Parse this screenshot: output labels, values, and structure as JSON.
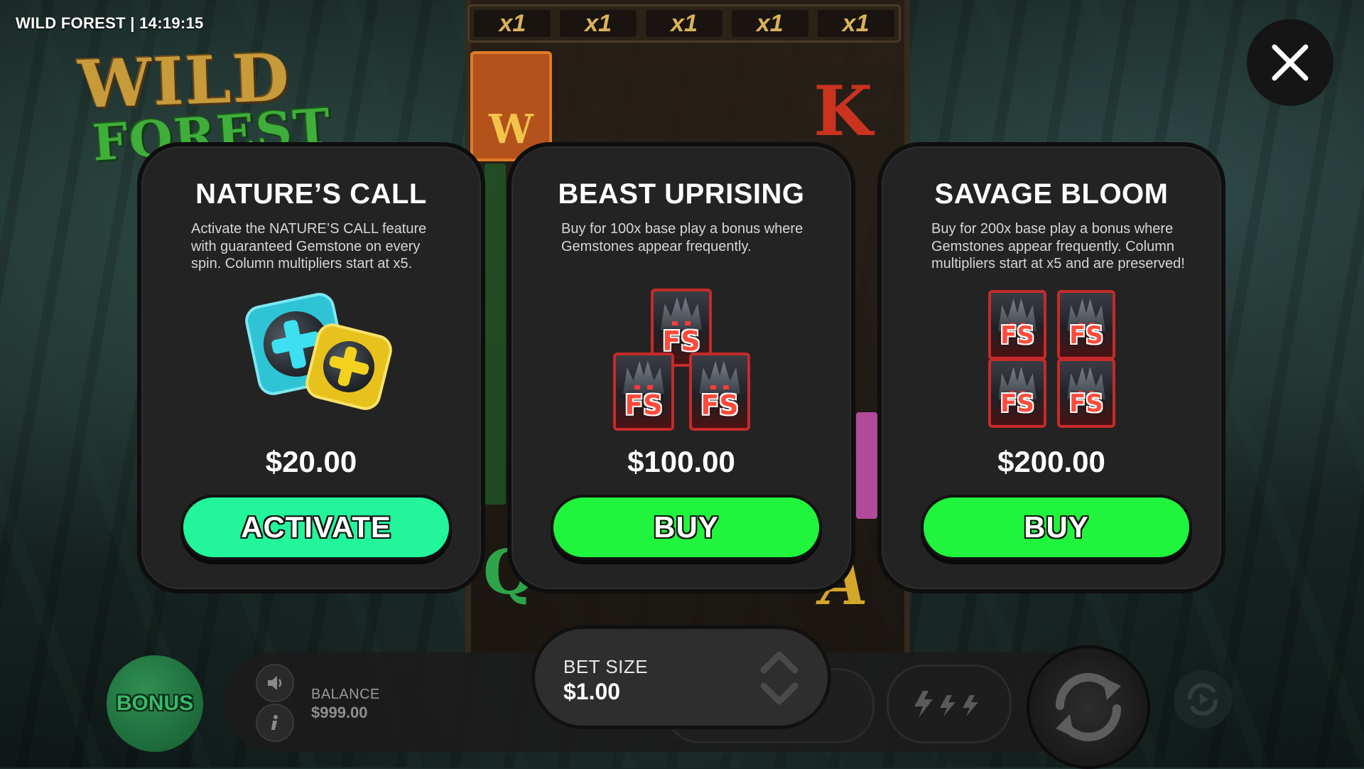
{
  "hud": {
    "title": "WILD FOREST | 14:19:15"
  },
  "logo": {
    "line1": "WILD",
    "line2": "FOREST"
  },
  "board": {
    "multipliers": [
      "x1",
      "x1",
      "x1",
      "x1",
      "x1"
    ],
    "symbols": {
      "w": "W",
      "k": "K",
      "a": "A",
      "q": "Q"
    }
  },
  "close": {
    "icon": "close-icon"
  },
  "cards": [
    {
      "title": "NATURE’S CALL",
      "description": "Activate the NATURE’S CALL feature with guaranteed Gemstone on every spin. Column multipliers start at x5.",
      "price": "$20.00",
      "button": "ACTIVATE",
      "button_color": "#22f59a",
      "art": "gemstone-icons"
    },
    {
      "title": "BEAST UPRISING",
      "description": "Buy for 100x base play a bonus where Gemstones appear frequently.",
      "price": "$100.00",
      "button": "BUY",
      "button_color": "#20f43c",
      "art": "fs-scatter-3",
      "fs_label": "FS"
    },
    {
      "title": "SAVAGE BLOOM",
      "description": "Buy for 200x base play a bonus where Gemstones appear frequently. Column multipliers start at x5 and are preserved!",
      "price": "$200.00",
      "button": "BUY",
      "button_color": "#20f43c",
      "art": "fs-scatter-4",
      "fs_label": "FS"
    }
  ],
  "bottom": {
    "bonus_label": "BONUS",
    "balance_label": "BALANCE",
    "balance_value": "$999.00",
    "bet_label": "BET SIZE",
    "bet_value": "$1.00",
    "icons": [
      "sound-icon",
      "info-icon",
      "bet-arrows-icon",
      "turbo-icon",
      "spin-icon",
      "autoplay-icon"
    ]
  },
  "colors": {
    "card_bg": "#232323",
    "activate_green": "#22f59a",
    "buy_green": "#20f43c",
    "fs_red": "#c62a2a"
  }
}
